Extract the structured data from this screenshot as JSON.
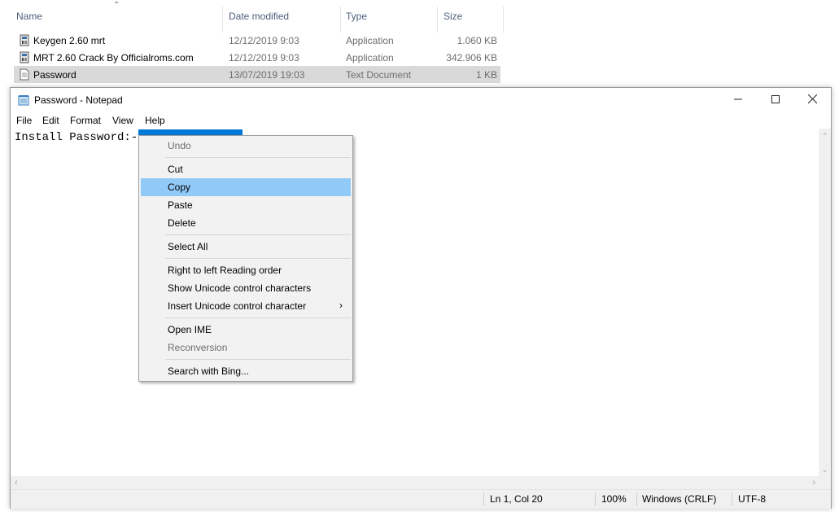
{
  "explorer": {
    "columns": {
      "name": "Name",
      "date_modified": "Date modified",
      "type": "Type",
      "size": "Size"
    },
    "files": [
      {
        "name": "Keygen 2.60 mrt",
        "date": "12/12/2019 9:03",
        "type": "Application",
        "size": "1.060 KB",
        "icon": "application-icon"
      },
      {
        "name": "MRT 2.60 Crack By Officialroms.com",
        "date": "12/12/2019 9:03",
        "type": "Application",
        "size": "342.906 KB",
        "icon": "application-icon"
      },
      {
        "name": "Password",
        "date": "13/07/2019 19:03",
        "type": "Text Document",
        "size": "1 KB",
        "icon": "text-document-icon"
      }
    ]
  },
  "notepad": {
    "title": "Password - Notepad",
    "menu": {
      "file": "File",
      "edit": "Edit",
      "format": "Format",
      "view": "View",
      "help": "Help"
    },
    "content": "Install Password:- ",
    "status": {
      "position": "Ln 1, Col 20",
      "zoom": "100%",
      "line_endings": "Windows (CRLF)",
      "encoding": "UTF-8"
    },
    "window_buttons": {
      "minimize": "minimize-icon",
      "maximize": "maximize-icon",
      "close": "close-icon"
    }
  },
  "context_menu": {
    "undo": "Undo",
    "cut": "Cut",
    "copy": "Copy",
    "paste": "Paste",
    "delete": "Delete",
    "select_all": "Select All",
    "rtl": "Right to left Reading order",
    "show_unicode": "Show Unicode control characters",
    "insert_unicode": "Insert Unicode control character",
    "open_ime": "Open IME",
    "reconversion": "Reconversion",
    "search_bing": "Search with Bing..."
  },
  "colors": {
    "selection": "#0078d7",
    "menu_highlight": "#91c9f7",
    "selected_row": "#d9d9d9"
  }
}
